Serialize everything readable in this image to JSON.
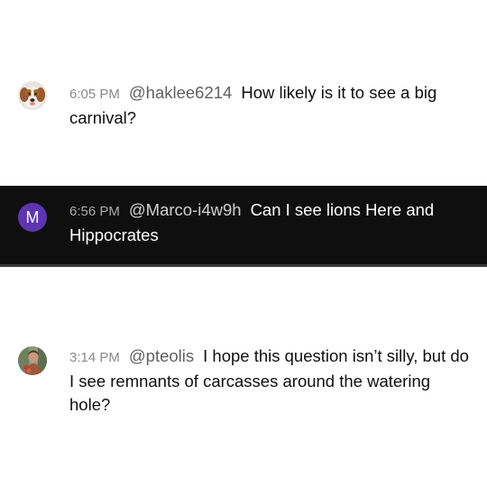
{
  "messages": [
    {
      "timestamp": "6:05 PM",
      "author": "@haklee6214",
      "text": "How likely is it to see a big carnival?",
      "avatar": "dog-photo"
    },
    {
      "timestamp": "6:56 PM",
      "author": "@Marco-i4w9h",
      "text": "Can I see lions Here and Hippocrates",
      "avatar_letter": "M",
      "avatar_color": "#5e35b1"
    },
    {
      "timestamp": "3:14 PM",
      "author": "@pteolis",
      "text": "I hope this question isn’t silly, but do I see remnants of carcasses around the watering hole?",
      "avatar": "person-photo"
    }
  ]
}
